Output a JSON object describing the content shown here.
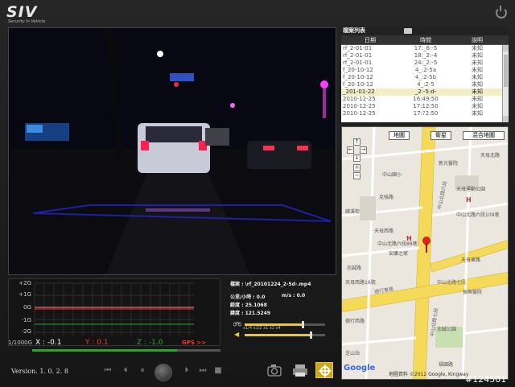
{
  "header": {
    "logo": "SIV",
    "logo_sub": "Security In Vehicle"
  },
  "file_list": {
    "title": "檔案列表",
    "columns": [
      "日期",
      "時間",
      "說明"
    ],
    "rows": [
      [
        "rf_2-01-01",
        "17:_6:-5",
        "未知"
      ],
      [
        "rf_2-01-01",
        "18:_2:-4",
        "未知"
      ],
      [
        "rf_2-01-01",
        "24:_2:-5",
        "未知"
      ],
      [
        "f_20-10-12",
        "4_:2-5a",
        "未知"
      ],
      [
        "f_20-10-12",
        "4_:2-5b",
        "未知"
      ],
      [
        "f_20-10-12",
        "4_:2-5",
        "未知"
      ],
      [
        "_201-01-22",
        "_2:-5:d-",
        "未知"
      ],
      [
        "2010-12-25",
        "16:49:50",
        "未知"
      ],
      [
        "2010-12-25",
        "17:12:50",
        "未知"
      ],
      [
        "2010-12-25",
        "17:?2:50",
        "未知"
      ]
    ],
    "selected_index": 6
  },
  "map": {
    "buttons": [
      "地圖",
      "衛星",
      "混合地圖"
    ],
    "nav": [
      "↑",
      "←",
      "→",
      "↓",
      "+",
      "−"
    ],
    "labels": [
      "中山北路六段",
      "克強路",
      "中山北路六段109巷",
      "天母西路",
      "天母運動公園",
      "天母北路",
      "德行東路",
      "中山北路七段",
      "忠誠公園",
      "忠誠路",
      "芝山站",
      "福國路",
      "中山北路六段88巷",
      "中山國小",
      "天母東路",
      "德行西路",
      "新光醫院",
      "磺溪街",
      "振興醫院",
      "安康之家",
      "天母西路16號",
      "中山北路七段"
    ],
    "copyright": "地圖資料 ©2012 Google, Kingway",
    "brand": "Google"
  },
  "graph": {
    "ticks": [
      "+2G",
      "+1G",
      "0G",
      "-1G",
      "-2G"
    ],
    "scale": "1/1000G",
    "x_label": "X : -0.1",
    "y_label": "Y : 0.1",
    "z_label": "Z : -1.0",
    "gps_label": "GPS >>",
    "progress": 0.77
  },
  "info": {
    "file": "檔案 : \\rf_20101224_2-5d-.mp4",
    "speed_mph": "公里/小時 : 0.0",
    "speed_ms": "m/s : 0.0",
    "longitude": "經度 : 25.1068",
    "latitude": "緯度 : 121.5249",
    "speed_ticks": "x1/4  x1/2  x1    x2    x4",
    "playback_level": 0.72,
    "volume_level": 0.82
  },
  "footer": {
    "version": "Version. 1. 0. 2. 8",
    "watermark": "#124501"
  },
  "colors": {
    "x_line": "#ff8a8a",
    "y_line": "#ff3030",
    "z_line": "#2fa52f",
    "gps": "#ff3030",
    "accent": "#e6c840"
  }
}
